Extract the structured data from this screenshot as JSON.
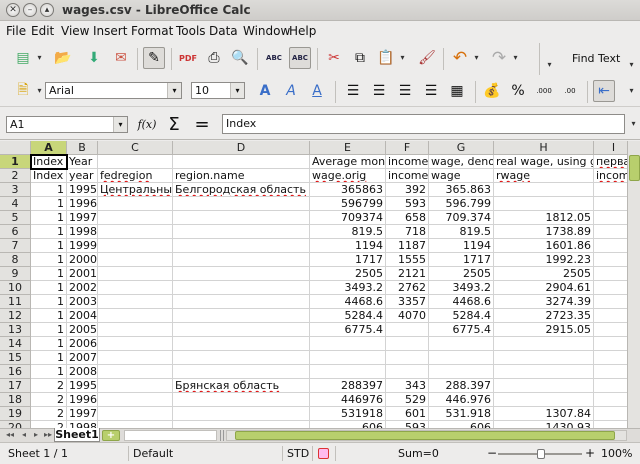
{
  "window": {
    "title": "wages.csv - LibreOffice Calc"
  },
  "menu": [
    "File",
    "Edit",
    "View",
    "Insert",
    "Format",
    "Tools",
    "Data",
    "Window",
    "Help"
  ],
  "toolbar": {
    "find_text_label": "Find Text",
    "font_name": "Arial",
    "font_size": "10",
    "percent_label": "%",
    "decimal_add_label": ".000",
    "decimal_remove_label": ".00"
  },
  "formula_bar": {
    "name_box": "A1",
    "function_label": "f(x)",
    "sum_label": "Σ",
    "equals_label": "=",
    "content": "Index"
  },
  "grid": {
    "columns": [
      "A",
      "B",
      "C",
      "D",
      "E",
      "F",
      "G",
      "H",
      "I"
    ],
    "selected_column": "A",
    "rows": [
      {
        "n": "1",
        "cells": [
          "Index",
          "Year",
          "",
          "",
          "Average month",
          "income",
          "wage, denom",
          "real wage, using gdp",
          "перва"
        ]
      },
      {
        "n": "2",
        "cells": [
          "Index",
          "year",
          "fedregion",
          "region.name",
          "wage.orig",
          "income",
          "wage",
          "rwage",
          "incom"
        ]
      },
      {
        "n": "3",
        "cells": [
          "1",
          "1995",
          "Центральный",
          "Белгородская область",
          "365863",
          "392",
          "365.863",
          "",
          ""
        ]
      },
      {
        "n": "4",
        "cells": [
          "1",
          "1996",
          "",
          "",
          "596799",
          "593",
          "596.799",
          "",
          ""
        ]
      },
      {
        "n": "5",
        "cells": [
          "1",
          "1997",
          "",
          "",
          "709374",
          "658",
          "709.374",
          "1812.05",
          ""
        ]
      },
      {
        "n": "6",
        "cells": [
          "1",
          "1998",
          "",
          "",
          "819.5",
          "718",
          "819.5",
          "1738.89",
          ""
        ]
      },
      {
        "n": "7",
        "cells": [
          "1",
          "1999",
          "",
          "",
          "1194",
          "1187",
          "1194",
          "1601.86",
          ""
        ]
      },
      {
        "n": "8",
        "cells": [
          "1",
          "2000",
          "",
          "",
          "1717",
          "1555",
          "1717",
          "1992.23",
          ""
        ]
      },
      {
        "n": "9",
        "cells": [
          "1",
          "2001",
          "",
          "",
          "2505",
          "2121",
          "2505",
          "2505",
          ""
        ]
      },
      {
        "n": "10",
        "cells": [
          "1",
          "2002",
          "",
          "",
          "3493.2",
          "2762",
          "3493.2",
          "2904.61",
          ""
        ]
      },
      {
        "n": "11",
        "cells": [
          "1",
          "2003",
          "",
          "",
          "4468.6",
          "3357",
          "4468.6",
          "3274.39",
          ""
        ]
      },
      {
        "n": "12",
        "cells": [
          "1",
          "2004",
          "",
          "",
          "5284.4",
          "4070",
          "5284.4",
          "2723.35",
          ""
        ]
      },
      {
        "n": "13",
        "cells": [
          "1",
          "2005",
          "",
          "",
          "6775.4",
          "",
          "6775.4",
          "2915.05",
          ""
        ]
      },
      {
        "n": "14",
        "cells": [
          "1",
          "2006",
          "",
          "",
          "",
          "",
          "",
          "",
          ""
        ]
      },
      {
        "n": "15",
        "cells": [
          "1",
          "2007",
          "",
          "",
          "",
          "",
          "",
          "",
          ""
        ]
      },
      {
        "n": "16",
        "cells": [
          "1",
          "2008",
          "",
          "",
          "",
          "",
          "",
          "",
          ""
        ]
      },
      {
        "n": "17",
        "cells": [
          "2",
          "1995",
          "",
          "Брянская область",
          "288397",
          "343",
          "288.397",
          "",
          ""
        ]
      },
      {
        "n": "18",
        "cells": [
          "2",
          "1996",
          "",
          "",
          "446976",
          "529",
          "446.976",
          "",
          ""
        ]
      },
      {
        "n": "19",
        "cells": [
          "2",
          "1997",
          "",
          "",
          "531918",
          "601",
          "531.918",
          "1307.84",
          ""
        ]
      },
      {
        "n": "20",
        "cells": [
          "2",
          "1998",
          "",
          "",
          "606",
          "593",
          "606",
          "1430.93",
          ""
        ]
      }
    ]
  },
  "sheet_tabs": {
    "active": "Sheet1",
    "add_label": "+"
  },
  "status": {
    "sheet": "Sheet 1 / 1",
    "style": "Default",
    "mode": "STD",
    "sum": "Sum=0",
    "zoom": "100%",
    "zoom_minus": "−",
    "zoom_plus": "+"
  }
}
